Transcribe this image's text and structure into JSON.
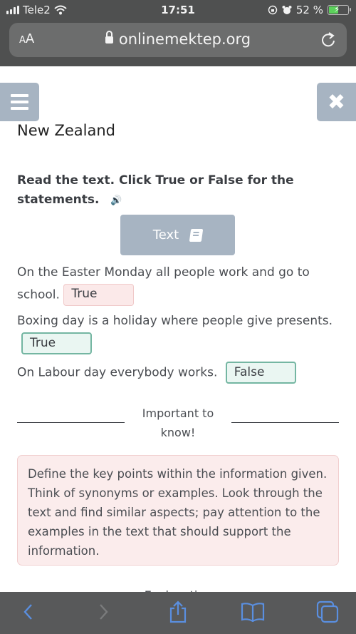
{
  "status_bar": {
    "carrier": "Tele2",
    "time": "17:51",
    "battery_percent_label": "52 %",
    "battery_level": 0.52,
    "icons": [
      "signal-icon",
      "wifi-icon",
      "orientation-lock-icon",
      "alarm-icon",
      "battery-charging-icon"
    ]
  },
  "browser": {
    "text_size_label_small": "A",
    "text_size_label_large": "A",
    "url": "onlinemektep.org",
    "lock_icon": "lock-icon",
    "reload_icon": "reload-icon",
    "toolbar_icons": [
      "back-icon",
      "forward-icon",
      "share-icon",
      "bookmarks-icon",
      "tabs-icon"
    ],
    "colors": {
      "toolbar_bg": "#58595a",
      "icon_active": "#5a8fe0",
      "icon_disabled": "#7a7b7c"
    }
  },
  "page": {
    "menu_icon": "hamburger-menu-icon",
    "close_icon": "close-icon",
    "close_glyph": "✖",
    "title": "New Zealand",
    "instruction": "Read the text. Click True or False for the statements.",
    "speaker_glyph": "🔊",
    "text_button_label": "Text",
    "statements": [
      {
        "text": "On the Easter Monday all people work and go to school.",
        "answer": "True",
        "status": "incorrect"
      },
      {
        "text": "Boxing day is a holiday where people give presents.",
        "answer": "True",
        "status": "correct"
      },
      {
        "text": "On Labour day everybody works.",
        "answer": "False",
        "status": "correct"
      }
    ],
    "divider_label_line1": "Important to",
    "divider_label_line2": "know!",
    "tip": "Define the key points within the information given. Think of synonyms or examples. Look through the text and find similar aspects; pay attention to the examples in the text that should support the information.",
    "partial_heading": "Explanation",
    "colors": {
      "button_bg": "#a7b4c2",
      "incorrect_bg": "#fbe9e9",
      "correct_bg": "#eaf6f2",
      "correct_border": "#74b6a2",
      "tip_bg": "#fbecec"
    }
  }
}
